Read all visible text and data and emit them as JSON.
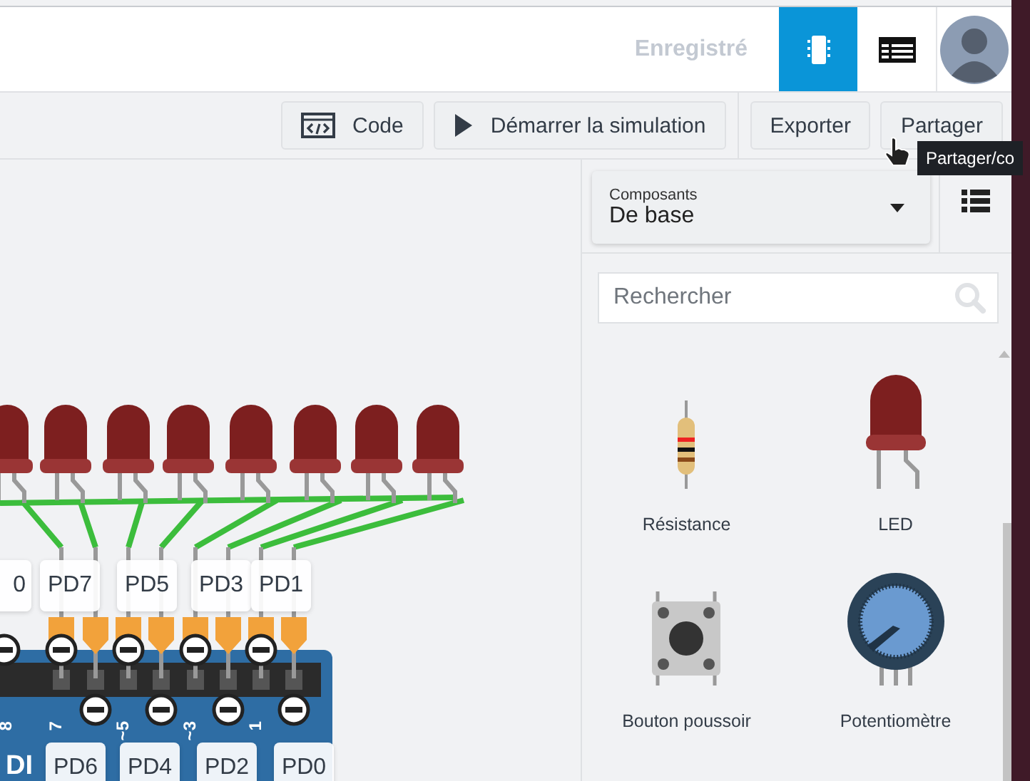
{
  "app": {
    "save_status": "Enregistré",
    "view_buttons": [
      {
        "kind": "components",
        "selected": true
      },
      {
        "kind": "table",
        "selected": false
      }
    ]
  },
  "toolbar": {
    "buttons": [
      {
        "kind": "code",
        "label": "Code"
      },
      {
        "kind": "play",
        "label": "Démarrer la simulation"
      },
      {
        "kind": "plain",
        "label": "Exporter"
      },
      {
        "kind": "plain",
        "label": "Partager"
      }
    ],
    "tooltip": "Partager/co"
  },
  "canvas": {
    "top_labels": [
      "0",
      "PD7",
      "PD5",
      "PD3",
      "PD1"
    ],
    "bottom_labels": [
      "PD6",
      "PD4",
      "PD2",
      "PD0"
    ],
    "board_text": "DI",
    "pin_numbers": [
      "8",
      "7",
      "~5",
      "~3",
      "1"
    ]
  },
  "panel": {
    "category": {
      "label": "Composants",
      "value": "De base"
    },
    "search": {
      "placeholder": "Rechercher"
    },
    "components": [
      {
        "kind": "resistor",
        "name": "Résistance"
      },
      {
        "kind": "led",
        "name": "LED"
      },
      {
        "kind": "button",
        "name": "Bouton poussoir"
      },
      {
        "kind": "potentiometer",
        "name": "Potentiomètre"
      }
    ]
  }
}
